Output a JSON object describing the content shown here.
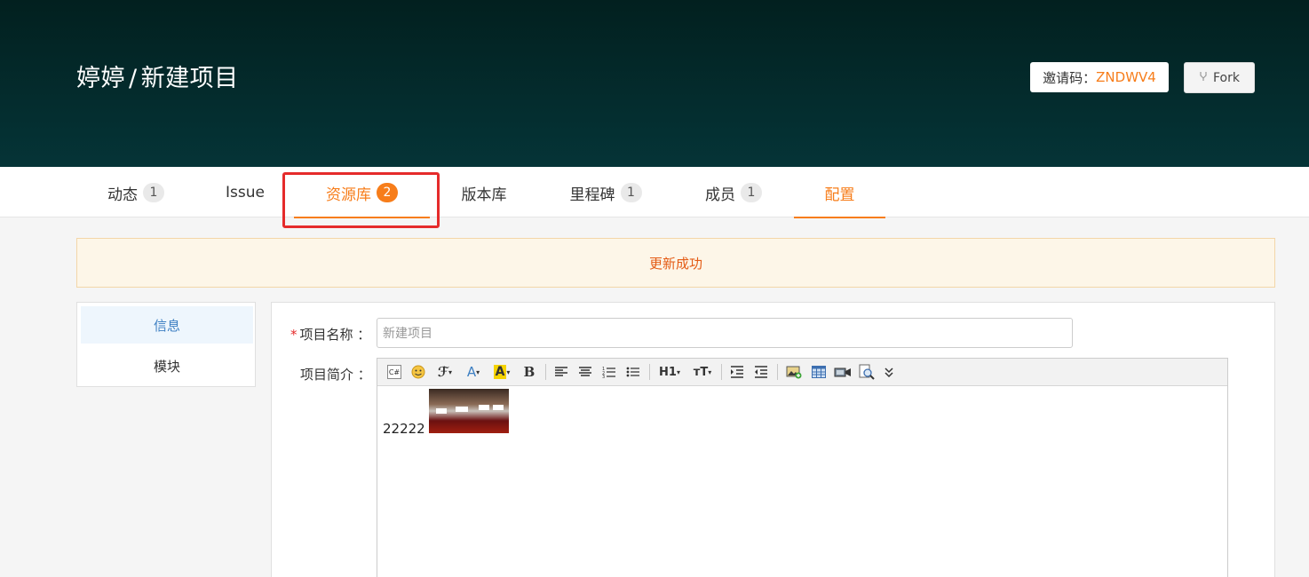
{
  "header": {
    "owner": "婷婷",
    "separator": "/",
    "project": "新建项目",
    "invite_label": "邀请码：",
    "invite_code": "ZNDWV4",
    "fork_label": "Fork"
  },
  "tabs": [
    {
      "label": "动态",
      "badge": "1"
    },
    {
      "label": "Issue",
      "badge": ""
    },
    {
      "label": "资源库",
      "badge": "2"
    },
    {
      "label": "版本库",
      "badge": ""
    },
    {
      "label": "里程碑",
      "badge": "1"
    },
    {
      "label": "成员",
      "badge": "1"
    },
    {
      "label": "配置",
      "badge": ""
    }
  ],
  "alert": {
    "message": "更新成功"
  },
  "sidebar": {
    "items": [
      {
        "label": "信息"
      },
      {
        "label": "模块"
      }
    ]
  },
  "form": {
    "name_label": "项目名称 ：",
    "name_required": "*",
    "name_value": "新建项目",
    "desc_label": "项目简介 ：",
    "desc_text": "22222"
  },
  "toolbar": {
    "items": [
      "html-source-icon",
      "emoji-icon",
      "font-family-icon",
      "font-color-icon",
      "highlight-icon",
      "bold-icon",
      "align-left-icon",
      "align-center-icon",
      "ordered-list-icon",
      "unordered-list-icon",
      "heading-icon",
      "font-size-icon",
      "indent-icon",
      "outdent-icon",
      "insert-image-icon",
      "table-icon",
      "media-icon",
      "preview-icon",
      "more-icon"
    ],
    "heading_label": "H1",
    "font_size_label": "тT",
    "bold_label": "B",
    "font_color_label": "A",
    "highlight_label": "A",
    "font_family_label": "ℱ"
  },
  "colors": {
    "accent": "#f77d1a",
    "header_bg": "#053437",
    "alert_bg": "#fdf6e8",
    "alert_text": "#e45b14",
    "annotation_box": "#e52b2b",
    "sidebar_active_text": "#3d7fc2"
  }
}
